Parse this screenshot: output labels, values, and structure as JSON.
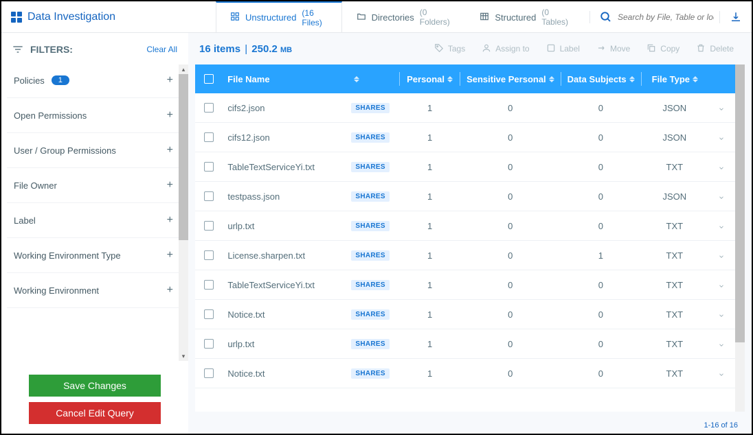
{
  "header": {
    "title": "Data Investigation"
  },
  "tabs": [
    {
      "label": "Unstructured",
      "count": "(16 Files)",
      "active": true
    },
    {
      "label": "Directories",
      "count": "(0 Folders)",
      "active": false
    },
    {
      "label": "Structured",
      "count": "(0 Tables)",
      "active": false
    }
  ],
  "search": {
    "placeholder": "Search by File, Table or loca"
  },
  "sidebar": {
    "filters_title": "FILTERS:",
    "clear_all": "Clear All",
    "items": [
      {
        "label": "Policies",
        "badge": "1"
      },
      {
        "label": "Open Permissions"
      },
      {
        "label": "User / Group Permissions"
      },
      {
        "label": "File Owner"
      },
      {
        "label": "Label"
      },
      {
        "label": "Working Environment Type"
      },
      {
        "label": "Working Environment"
      }
    ],
    "save_btn": "Save Changes",
    "cancel_btn": "Cancel Edit Query"
  },
  "toolbar": {
    "items_count": "16 items",
    "size_value": "250.2",
    "size_unit": "MB",
    "actions": {
      "tags": "Tags",
      "assign": "Assign to",
      "label": "Label",
      "move": "Move",
      "copy": "Copy",
      "delete": "Delete"
    }
  },
  "columns": {
    "name": "File Name",
    "personal": "Personal",
    "sensitive": "Sensitive Personal",
    "subjects": "Data Subjects",
    "type": "File Type"
  },
  "rows": [
    {
      "name": "cifs2.json",
      "badge": "SHARES",
      "personal": "1",
      "sensitive": "0",
      "subjects": "0",
      "type": "JSON"
    },
    {
      "name": "cifs12.json",
      "badge": "SHARES",
      "personal": "1",
      "sensitive": "0",
      "subjects": "0",
      "type": "JSON"
    },
    {
      "name": "TableTextServiceYi.txt",
      "badge": "SHARES",
      "personal": "1",
      "sensitive": "0",
      "subjects": "0",
      "type": "TXT"
    },
    {
      "name": "testpass.json",
      "badge": "SHARES",
      "personal": "1",
      "sensitive": "0",
      "subjects": "0",
      "type": "JSON"
    },
    {
      "name": "urlp.txt",
      "badge": "SHARES",
      "personal": "1",
      "sensitive": "0",
      "subjects": "0",
      "type": "TXT"
    },
    {
      "name": "License.sharpen.txt",
      "badge": "SHARES",
      "personal": "1",
      "sensitive": "0",
      "subjects": "1",
      "type": "TXT"
    },
    {
      "name": "TableTextServiceYi.txt",
      "badge": "SHARES",
      "personal": "1",
      "sensitive": "0",
      "subjects": "0",
      "type": "TXT"
    },
    {
      "name": "Notice.txt",
      "badge": "SHARES",
      "personal": "1",
      "sensitive": "0",
      "subjects": "0",
      "type": "TXT"
    },
    {
      "name": "urlp.txt",
      "badge": "SHARES",
      "personal": "1",
      "sensitive": "0",
      "subjects": "0",
      "type": "TXT"
    },
    {
      "name": "Notice.txt",
      "badge": "SHARES",
      "personal": "1",
      "sensitive": "0",
      "subjects": "0",
      "type": "TXT"
    }
  ],
  "footer": {
    "range": "1-16 of 16"
  }
}
